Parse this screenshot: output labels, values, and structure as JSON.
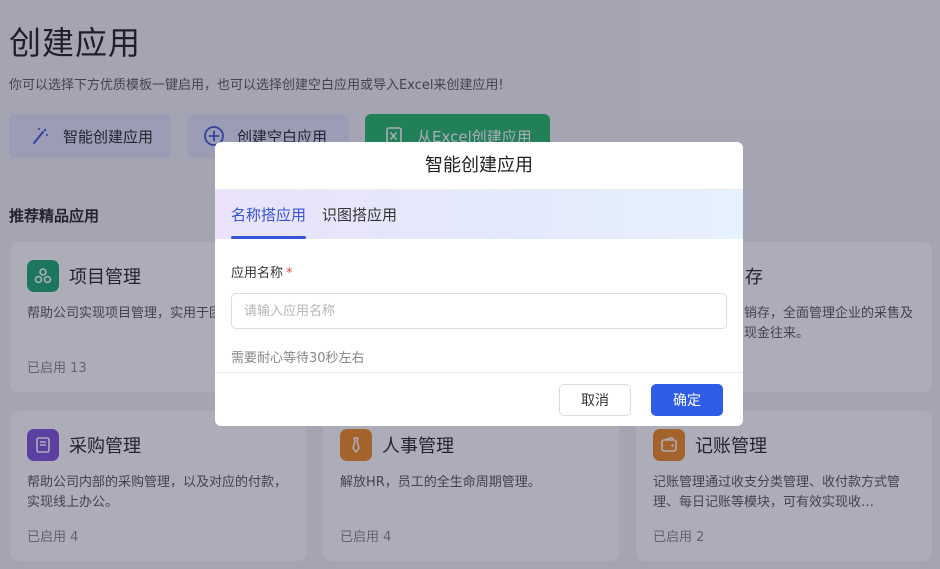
{
  "page": {
    "title": "创建应用",
    "subtitle": "你可以选择下方优质模板一键启用，也可以选择创建空白应用或导入Excel来创建应用!"
  },
  "actions": {
    "smart_label": "智能创建应用",
    "blank_label": "创建空白应用",
    "excel_label": "从Excel创建应用"
  },
  "section": {
    "title": "推荐精品应用"
  },
  "cards": [
    {
      "name": "项目管理",
      "desc": "帮助公司实现项目管理，实用于团公司。",
      "meta": "已启用 13",
      "icon": "cluster-icon",
      "color": "#16a86b"
    },
    {
      "name": "",
      "desc": "",
      "meta": "",
      "icon": "",
      "color": ""
    },
    {
      "name": "存",
      "desc": "销存，全面管理企业的采售及现金往来。",
      "meta": "",
      "icon": "",
      "color": ""
    },
    {
      "name": "采购管理",
      "desc": "帮助公司内部的采购管理，以及对应的付款，实现线上办公。",
      "meta": "已启用 4",
      "icon": "book-icon",
      "color": "#7b4fd9"
    },
    {
      "name": "人事管理",
      "desc": "解放HR，员工的全生命周期管理。",
      "meta": "已启用 4",
      "icon": "tie-icon",
      "color": "#ef8a1a"
    },
    {
      "name": "记账管理",
      "desc": "记账管理通过收支分类管理、收付款方式管理、每日记账等模块，可有效实现收…",
      "meta": "已启用 2",
      "icon": "wallet-icon",
      "color": "#ef8a1a"
    }
  ],
  "modal": {
    "title": "智能创建应用",
    "tabs": [
      "名称搭应用",
      "识图搭应用"
    ],
    "active_tab": 0,
    "field_label": "应用名称",
    "required_mark": "*",
    "input_value": "",
    "input_placeholder": "请输入应用名称",
    "hint": "需要耐心等待30秒左右",
    "cancel_label": "取消",
    "ok_label": "确定"
  },
  "colors": {
    "primary": "#2f5de8",
    "excel_green": "#1fb865",
    "tab_active": "#3354d8"
  }
}
